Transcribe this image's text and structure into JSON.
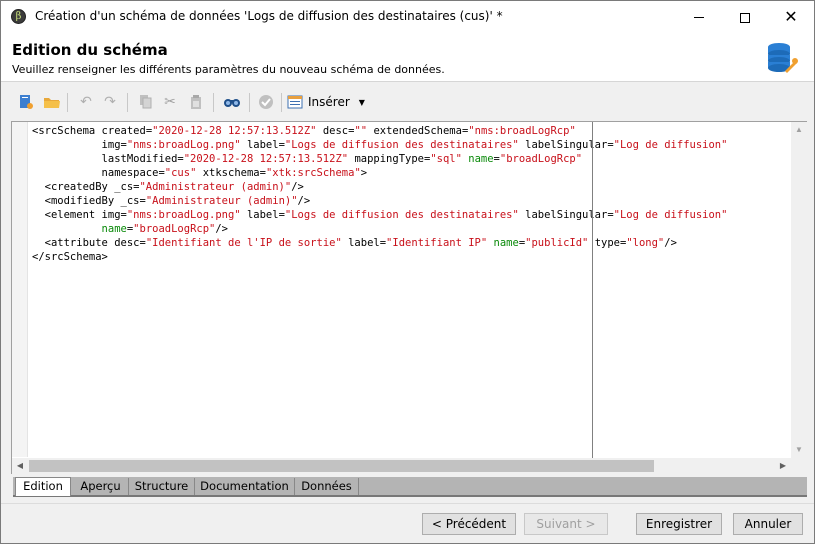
{
  "window": {
    "title": "Création d'un schéma de données 'Logs de diffusion des destinataires (cus)' *"
  },
  "header": {
    "title": "Edition du schéma",
    "subtitle": "Veuillez renseigner les différents paramètres du nouveau schéma de données."
  },
  "toolbar": {
    "insert_label": "Insérer",
    "icons": [
      "new-icon",
      "open-folder-icon",
      "undo-icon",
      "redo-icon",
      "copy-icon",
      "cut-icon",
      "paste-icon",
      "find-icon",
      "validate-icon",
      "insert-icon"
    ]
  },
  "editor": {
    "lines": [
      "<srcSchema created=\"2020-12-28 12:57:13.512Z\" desc=\"\" extendedSchema=\"nms:broadLogRcp\"",
      "           img=\"nms:broadLog.png\" label=\"Logs de diffusion des destinataires\" labelSingular=\"Log de diffusion\"",
      "           lastModified=\"2020-12-28 12:57:13.512Z\" mappingType=\"sql\" name=\"broadLogRcp\"",
      "           namespace=\"cus\" xtkschema=\"xtk:srcSchema\">",
      "  <createdBy _cs=\"Administrateur (admin)\"/>",
      "  <modifiedBy _cs=\"Administrateur (admin)\"/>",
      "  <element img=\"nms:broadLog.png\" label=\"Logs de diffusion des destinataires\" labelSingular=\"Log de diffusion\"",
      "           name=\"broadLogRcp\"/>",
      "  <attribute desc=\"Identifiant de l'IP de sortie\" label=\"Identifiant IP\" name=\"publicId\" type=\"long\"/>",
      "</srcSchema>"
    ]
  },
  "tabs": [
    "Edition",
    "Aperçu",
    "Structure",
    "Documentation",
    "Données"
  ],
  "buttons": {
    "previous": "< Précédent",
    "next": "Suivant >",
    "save": "Enregistrer",
    "cancel": "Annuler"
  }
}
